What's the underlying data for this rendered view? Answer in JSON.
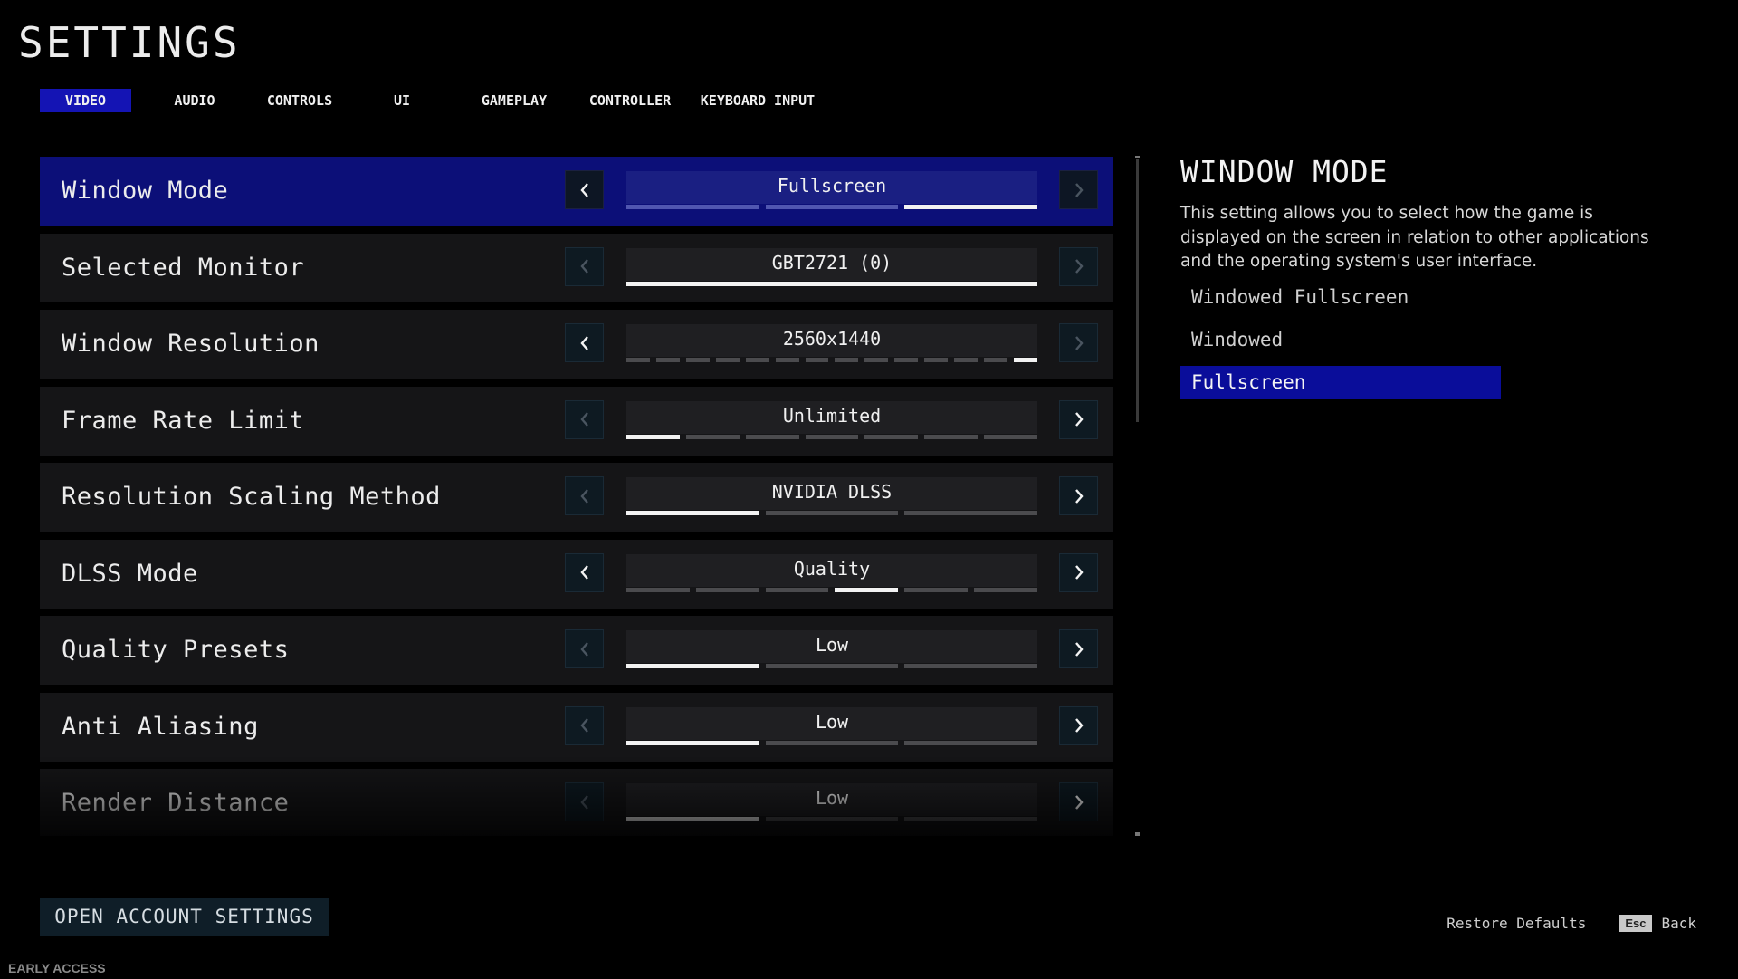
{
  "page": {
    "title": "SETTINGS"
  },
  "tabs": [
    {
      "label": "VIDEO",
      "active": true
    },
    {
      "label": "AUDIO",
      "active": false
    },
    {
      "label": "CONTROLS",
      "active": false
    },
    {
      "label": "UI",
      "active": false
    },
    {
      "label": "GAMEPLAY",
      "active": false
    },
    {
      "label": "CONTROLLER",
      "active": false
    },
    {
      "label": "KEYBOARD INPUT",
      "active": false
    }
  ],
  "settings": [
    {
      "label": "Window Mode",
      "value": "Fullscreen",
      "options_count": 3,
      "selected_index": 2,
      "left_enabled": true,
      "right_enabled": false,
      "selected": true
    },
    {
      "label": "Selected Monitor",
      "value": "GBT2721 (0)",
      "options_count": 1,
      "selected_index": 0,
      "left_enabled": false,
      "right_enabled": false,
      "selected": false
    },
    {
      "label": "Window Resolution",
      "value": "2560x1440",
      "options_count": 14,
      "selected_index": 13,
      "left_enabled": true,
      "right_enabled": false,
      "selected": false
    },
    {
      "label": "Frame Rate Limit",
      "value": "Unlimited",
      "options_count": 7,
      "selected_index": 0,
      "left_enabled": false,
      "right_enabled": true,
      "selected": false
    },
    {
      "label": "Resolution Scaling Method",
      "value": "NVIDIA DLSS",
      "options_count": 3,
      "selected_index": 0,
      "left_enabled": false,
      "right_enabled": true,
      "selected": false
    },
    {
      "label": "DLSS Mode",
      "value": "Quality",
      "options_count": 6,
      "selected_index": 3,
      "left_enabled": true,
      "right_enabled": true,
      "selected": false
    },
    {
      "label": "Quality Presets",
      "value": "Low",
      "options_count": 3,
      "selected_index": 0,
      "left_enabled": false,
      "right_enabled": true,
      "selected": false
    },
    {
      "label": "Anti Aliasing",
      "value": "Low",
      "options_count": 3,
      "selected_index": 0,
      "left_enabled": false,
      "right_enabled": true,
      "selected": false
    },
    {
      "label": "Render Distance",
      "value": "Low",
      "options_count": 3,
      "selected_index": 0,
      "left_enabled": false,
      "right_enabled": true,
      "selected": false
    }
  ],
  "description": {
    "title": "WINDOW MODE",
    "text": "This setting allows you to select how the game is displayed on the screen in relation to other applications and the operating system's user interface.",
    "options": [
      {
        "label": "Windowed Fullscreen",
        "selected": false
      },
      {
        "label": "Windowed",
        "selected": false
      },
      {
        "label": "Fullscreen",
        "selected": true
      }
    ]
  },
  "footer": {
    "account_button": "OPEN ACCOUNT SETTINGS",
    "early_access": "EARLY ACCESS",
    "restore_defaults": "Restore Defaults",
    "esc_key": "Esc",
    "back": "Back"
  },
  "colors": {
    "accent_blue": "#1414b4",
    "row_selected": "#0c0f78",
    "option_selected": "#0a0d9a"
  },
  "icons": {
    "left_arrow": "chevron-left-icon",
    "right_arrow": "chevron-right-icon"
  }
}
